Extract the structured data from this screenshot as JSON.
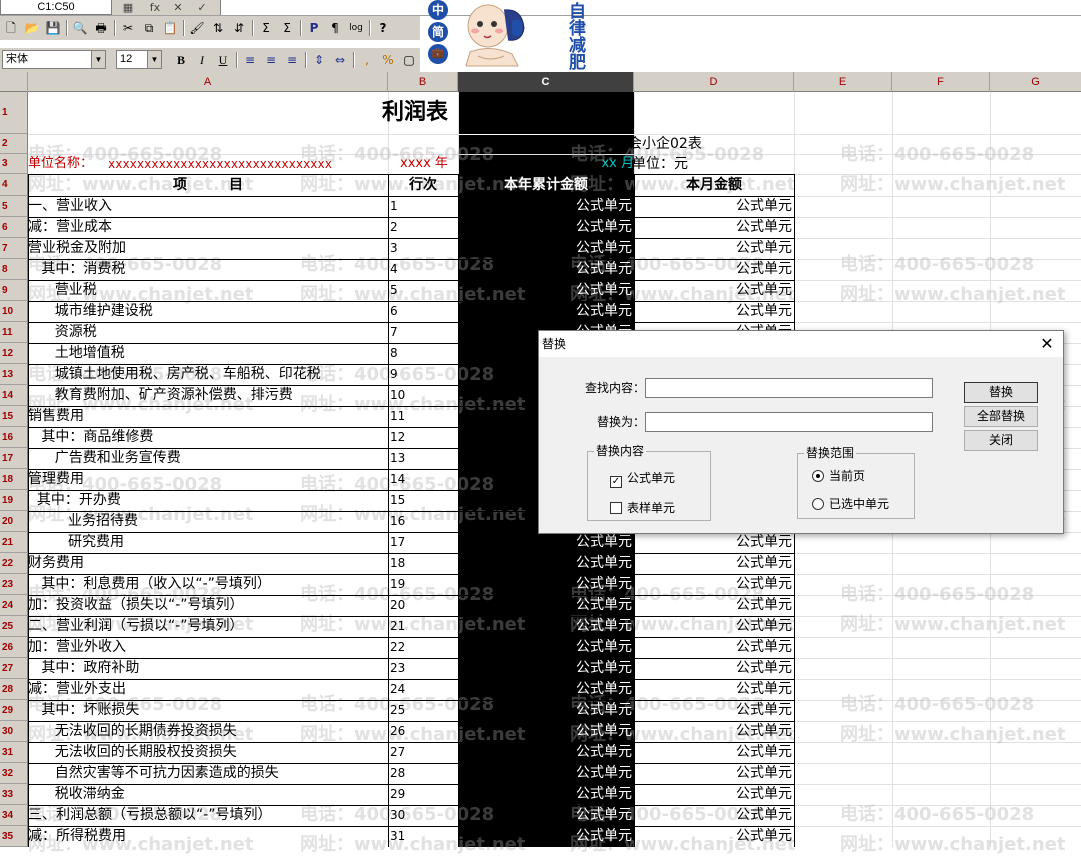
{
  "formula_bar": {
    "cell_ref": "C1:C50",
    "buttons": [
      {
        "name": "range-icon",
        "glyph": "▦"
      },
      {
        "name": "function-icon",
        "glyph": "fx"
      },
      {
        "name": "cancel-icon",
        "glyph": "✕"
      },
      {
        "name": "confirm-icon",
        "glyph": "✓"
      }
    ]
  },
  "toolbar1": [
    {
      "name": "new-icon",
      "glyph": "🗋"
    },
    {
      "name": "open-icon",
      "glyph": "📂"
    },
    {
      "name": "save-icon",
      "glyph": "💾"
    },
    {
      "name": "print-preview-icon",
      "glyph": "🔍"
    },
    {
      "name": "print-icon",
      "glyph": "🖶"
    },
    {
      "name": "cut-icon",
      "glyph": "✂"
    },
    {
      "name": "copy-icon",
      "glyph": "⧉"
    },
    {
      "name": "paste-icon",
      "glyph": "📋"
    },
    {
      "name": "format-painter-icon",
      "glyph": "🖌"
    },
    {
      "name": "sort-asc-icon",
      "glyph": "⇅"
    },
    {
      "name": "sort-desc-icon",
      "glyph": "⇵"
    },
    {
      "name": "sum-icon",
      "glyph": "Σ"
    },
    {
      "name": "subtotal-icon",
      "glyph": "Σ"
    },
    {
      "name": "param-icon",
      "glyph": "P"
    },
    {
      "name": "wrap-icon",
      "glyph": "¶"
    },
    {
      "name": "calc-icon",
      "glyph": "log"
    },
    {
      "name": "help-icon",
      "glyph": "?"
    }
  ],
  "toolbar2": {
    "font_name": "宋体",
    "font_size": "12",
    "buttons": [
      {
        "name": "bold-button",
        "glyph": "B",
        "cls": "bold"
      },
      {
        "name": "italic-button",
        "glyph": "I",
        "cls": "italic"
      },
      {
        "name": "underline-button",
        "glyph": "U",
        "cls": "under"
      },
      {
        "name": "align-left-icon",
        "glyph": "≡",
        "cls": ""
      },
      {
        "name": "align-center-icon",
        "glyph": "≡",
        "cls": ""
      },
      {
        "name": "align-right-icon",
        "glyph": "≡",
        "cls": ""
      },
      {
        "name": "vertical-align-icon",
        "glyph": "⇕",
        "cls": ""
      },
      {
        "name": "merge-icon",
        "glyph": "⇔",
        "cls": ""
      },
      {
        "name": "thousands-icon",
        "glyph": ",",
        "cls": ""
      },
      {
        "name": "percent-icon",
        "glyph": "%",
        "cls": ""
      },
      {
        "name": "border-icon",
        "glyph": "▢",
        "cls": ""
      }
    ]
  },
  "logo": {
    "chars": [
      "中",
      "简",
      "💼"
    ],
    "slogan": "自律减肥"
  },
  "columns": [
    "A",
    "B",
    "C",
    "D",
    "E",
    "F",
    "G"
  ],
  "selected_column": "C",
  "sheet": {
    "title": "利润表",
    "form_code": "会小企02表",
    "unit_label": "单位名称：",
    "unit_value": "xxxxxxxxxxxxxxxxxxxxxxxxxxxxxxx",
    "year_text": "xxxx 年",
    "month_text": "xx 月",
    "currency_text": "单位：元",
    "headers": [
      "项　　　目",
      "行次",
      "本年累计金额",
      "本月金额"
    ],
    "formula_text": "公式单元",
    "rows": [
      {
        "item": "一、营业收入",
        "idx": "1"
      },
      {
        "item": "减：营业成本",
        "idx": "2"
      },
      {
        "item": "营业税金及附加",
        "idx": "3"
      },
      {
        "item": "   其中：消费税",
        "idx": "4"
      },
      {
        "item": "      营业税",
        "idx": "5"
      },
      {
        "item": "      城市维护建设税",
        "idx": "6"
      },
      {
        "item": "      资源税",
        "idx": "7"
      },
      {
        "item": "      土地增值税",
        "idx": "8"
      },
      {
        "item": "      城镇土地使用税、房产税、车船税、印花税",
        "idx": "9"
      },
      {
        "item": "      教育费附加、矿产资源补偿费、排污费",
        "idx": "10"
      },
      {
        "item": "销售费用",
        "idx": "11"
      },
      {
        "item": "   其中：商品维修费",
        "idx": "12"
      },
      {
        "item": "      广告费和业务宣传费",
        "idx": "13"
      },
      {
        "item": "管理费用",
        "idx": "14"
      },
      {
        "item": "  其中：开办费",
        "idx": "15"
      },
      {
        "item": "         业务招待费",
        "idx": "16"
      },
      {
        "item": "         研究费用",
        "idx": "17"
      },
      {
        "item": "财务费用",
        "idx": "18"
      },
      {
        "item": "   其中：利息费用（收入以“-”号填列）",
        "idx": "19"
      },
      {
        "item": "加：投资收益（损失以“-”号填列）",
        "idx": "20"
      },
      {
        "item": "二、营业利润（亏损以“-”号填列）",
        "idx": "21"
      },
      {
        "item": "加：营业外收入",
        "idx": "22"
      },
      {
        "item": "   其中：政府补助",
        "idx": "23"
      },
      {
        "item": "减：营业外支出",
        "idx": "24"
      },
      {
        "item": "   其中：坏账损失",
        "idx": "25"
      },
      {
        "item": "      无法收回的长期债券投资损失",
        "idx": "26"
      },
      {
        "item": "      无法收回的长期股权投资损失",
        "idx": "27"
      },
      {
        "item": "      自然灾害等不可抗力因素造成的损失",
        "idx": "28"
      },
      {
        "item": "      税收滞纳金",
        "idx": "29"
      },
      {
        "item": "三、利润总额（亏损总额以“-”号填列）",
        "idx": "30"
      },
      {
        "item": "减：所得税费用",
        "idx": "31"
      }
    ]
  },
  "watermark": {
    "phone": "电话：400-665-0028",
    "site": "网址：www.chanjet.net"
  },
  "dialog": {
    "title": "替换",
    "find_label": "查找内容：",
    "find_value": "",
    "replace_label": "替换为：",
    "replace_value": "",
    "btn_replace": "替换",
    "btn_replace_all": "全部替换",
    "btn_close": "关闭",
    "content_group": "替换内容",
    "opt_formula": "公式单元",
    "opt_formula_checked": true,
    "opt_sample": "表样单元",
    "opt_sample_checked": false,
    "range_group": "替换范围",
    "opt_current": "当前页",
    "opt_current_checked": true,
    "opt_selected": "已选中单元",
    "opt_selected_checked": false
  }
}
